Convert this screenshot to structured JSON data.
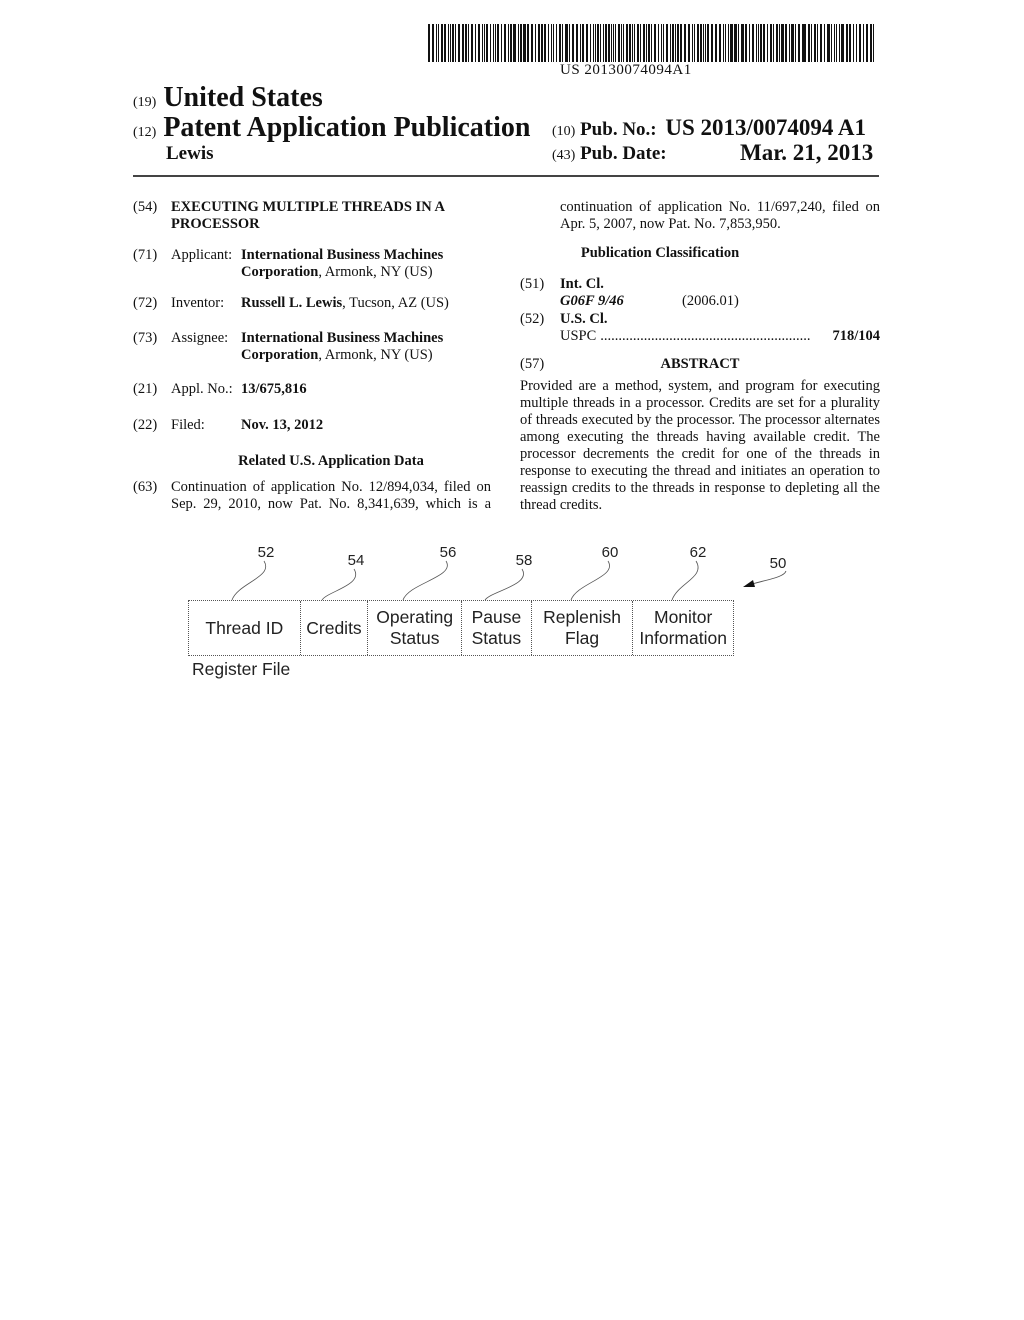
{
  "barcode": {
    "number": "US 20130074094A1"
  },
  "header": {
    "country_code": "(19)",
    "country": "United States",
    "type_code": "(12)",
    "type": "Patent Application Publication",
    "author": "Lewis",
    "pub_no_code": "(10)",
    "pub_no_label": "Pub. No.:",
    "pub_no": "US 2013/0074094 A1",
    "pub_date_code": "(43)",
    "pub_date_label": "Pub. Date:",
    "pub_date": "Mar. 21, 2013"
  },
  "left": {
    "title": {
      "code": "(54)",
      "line1": "EXECUTING MULTIPLE THREADS IN A",
      "line2": "PROCESSOR"
    },
    "applicant": {
      "code": "(71)",
      "label": "Applicant:",
      "name1": "International Business Machines",
      "name2": "Corporation",
      "loc": ", Armonk, NY (US)"
    },
    "inventor": {
      "code": "(72)",
      "label": "Inventor:",
      "name": "Russell L. Lewis",
      "loc": ", Tucson, AZ (US)"
    },
    "assignee": {
      "code": "(73)",
      "label": "Assignee:",
      "name1": "International Business Machines",
      "name2": "Corporation",
      "loc": ", Armonk, NY (US)"
    },
    "appl_no": {
      "code": "(21)",
      "label": "Appl. No.:",
      "value": "13/675,816"
    },
    "filed": {
      "code": "(22)",
      "label": "Filed:",
      "value": "Nov. 13, 2012"
    },
    "related_heading": "Related U.S. Application Data",
    "continuation": {
      "code": "(63)",
      "line1": "Continuation of application No. 12/894,034, filed on",
      "line2": "Sep. 29, 2010, now Pat. No. 8,341,639, which is a"
    }
  },
  "right": {
    "continuation_line1": "continuation of application No. 11/697,240, filed on",
    "continuation_line2": "Apr. 5, 2007, now Pat. No. 7,853,950.",
    "classification_heading": "Publication Classification",
    "int_cl": {
      "code": "(51)",
      "label": "Int. Cl.",
      "class": "G06F 9/46",
      "version": "(2006.01)"
    },
    "us_cl": {
      "code": "(52)",
      "label": "U.S. Cl.",
      "uspc_label": "USPC",
      "dots": "..........................................................",
      "uspc_value": "718/104"
    },
    "abstract": {
      "code": "(57)",
      "heading": "ABSTRACT",
      "lines": [
        "Provided are a method, system, and program for executing",
        "multiple threads in a processor. Credits are set for a plurality",
        "of threads executed by the processor. The processor alternates",
        "among executing the threads having available credit. The",
        "processor decrements the credit for one of the threads in",
        "response to executing the thread and initiates an operation to",
        "reassign credits to the threads in response to depleting all the",
        "thread credits."
      ]
    }
  },
  "diagram": {
    "figure_ref": "50",
    "caption": "Register File",
    "fields": [
      {
        "ref": "52",
        "line1": "Thread ID",
        "line2": ""
      },
      {
        "ref": "54",
        "line1": "Credits",
        "line2": ""
      },
      {
        "ref": "56",
        "line1": "Operating",
        "line2": "Status"
      },
      {
        "ref": "58",
        "line1": "Pause",
        "line2": "Status"
      },
      {
        "ref": "60",
        "line1": "Replenish",
        "line2": "Flag"
      },
      {
        "ref": "62",
        "line1": "Monitor",
        "line2": "Information"
      }
    ]
  }
}
